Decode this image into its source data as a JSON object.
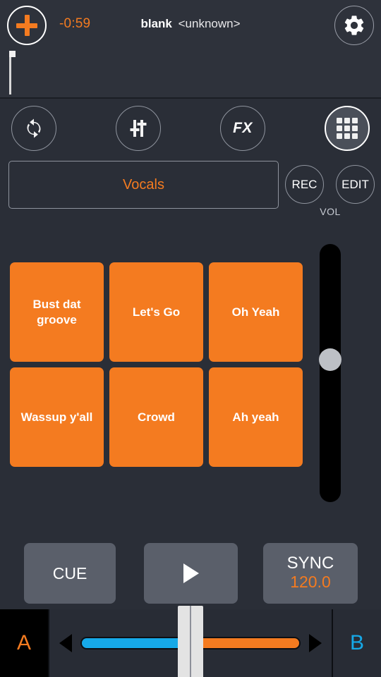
{
  "header": {
    "add_button": "add-track",
    "time_remaining": "-0:59",
    "track_name": "blank",
    "track_artist": "<unknown>",
    "settings_button": "settings",
    "beatgrid_button": "beatgrid"
  },
  "icon_row": {
    "loop": "loop",
    "eq": "eq-mixer",
    "fx": "FX",
    "grid": "pad-grid"
  },
  "selector": {
    "bank_name": "Vocals",
    "rec_label": "REC",
    "edit_label": "EDIT",
    "vol_label": "VOL"
  },
  "pads": [
    {
      "label": "Bust dat groove"
    },
    {
      "label": "Let's Go"
    },
    {
      "label": "Oh Yeah"
    },
    {
      "label": "Wassup y'all"
    },
    {
      "label": "Crowd"
    },
    {
      "label": "Ah yeah"
    }
  ],
  "volume": {
    "label": "VOL",
    "value_percent": 50
  },
  "transport": {
    "cue_label": "CUE",
    "play_label": "play",
    "sync_label": "SYNC",
    "bpm": "120.0"
  },
  "crossfader": {
    "deck_a": "A",
    "deck_b": "B",
    "position_percent": 50,
    "left_color": "#16a9e8",
    "right_color": "#f47b20"
  },
  "colors": {
    "accent_orange": "#f47b20",
    "accent_blue": "#16a9e8",
    "background": "#2a2e37",
    "panel": "#2e323b",
    "button_grey": "#5a5f6a"
  }
}
